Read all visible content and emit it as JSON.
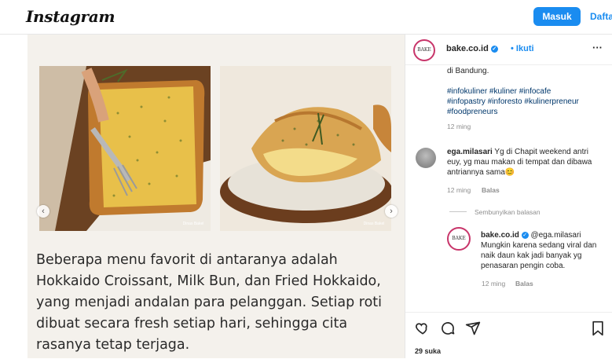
{
  "header": {
    "logo": "Instagram",
    "login_label": "Masuk",
    "signup_label": "Dafta"
  },
  "post": {
    "photo1_watermark": "Dinas Bakel",
    "photo2_watermark": "Dinas Bakel",
    "caption": "Beberapa menu favorit di antaranya adalah Hokkaido Croissant, Milk Bun, dan Fried Hokkaido, yang menjadi andalan para pelanggan. Setiap roti dibuat secara fresh setiap hari, sehingga cita rasanya tetap terjaga."
  },
  "panel": {
    "account": "bake.co.id",
    "follow_label": "Ikuti",
    "avatar_text": "BAKE",
    "caption_tail": "di Bandung.",
    "hashtags": "#infokuliner #kuliner #infocafe #infopastry #inforesto #kulinerpreneur #foodpreneurs",
    "caption_time": "12 ming",
    "comments": [
      {
        "user": "ega.milasari",
        "text": "Yg di Chapit weekend antri euy, yg mau makan di tempat dan dibawa antriannya sama😊",
        "time": "12 ming",
        "reply_label": "Balas"
      }
    ],
    "hide_replies_label": "Sembunyikan balasan",
    "reply": {
      "user": "bake.co.id",
      "mention": "@ega.milasari",
      "text": "Mungkin karena sedang viral dan naik daun kak jadi banyak yg penasaran pengin coba.",
      "time": "12 ming",
      "reply_label": "Balas"
    },
    "likes": "29 suka"
  },
  "colors": {
    "accent": "#1a8cf0",
    "link": "#00376b",
    "story_ring": "#c8356a"
  }
}
